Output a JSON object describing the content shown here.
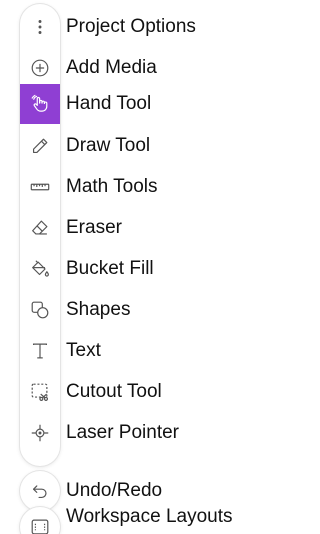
{
  "toolbar": {
    "items": [
      {
        "label": "Project Options",
        "icon": "more-vertical-icon"
      },
      {
        "label": "Add Media",
        "icon": "add-circle-icon"
      },
      {
        "label": "Hand Tool",
        "icon": "hand-pointer-icon",
        "active": true
      },
      {
        "label": "Draw Tool",
        "icon": "pencil-icon"
      },
      {
        "label": "Math Tools",
        "icon": "ruler-icon"
      },
      {
        "label": "Eraser",
        "icon": "eraser-icon"
      },
      {
        "label": "Bucket Fill",
        "icon": "bucket-fill-icon"
      },
      {
        "label": "Shapes",
        "icon": "shapes-icon"
      },
      {
        "label": "Text",
        "icon": "text-icon"
      },
      {
        "label": "Cutout Tool",
        "icon": "cutout-scissors-icon"
      },
      {
        "label": "Laser Pointer",
        "icon": "laser-pointer-icon"
      }
    ]
  },
  "bottom": {
    "undo_label": "Undo/Redo",
    "undo_icon": "undo-icon",
    "layouts_label": "Workspace Layouts",
    "layouts_icon": "workspace-layout-icon"
  },
  "colors": {
    "accent": "#8f3fd3",
    "icon": "#666666",
    "text": "#111111"
  }
}
